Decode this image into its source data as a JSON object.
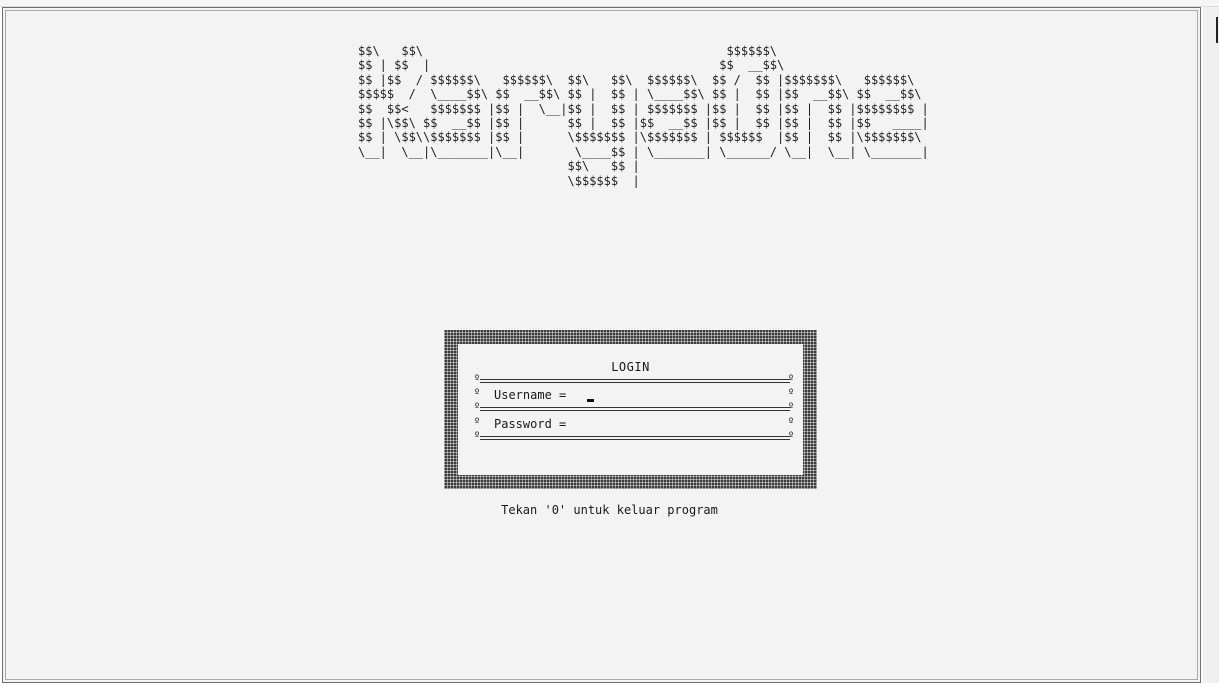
{
  "banner": {
    "ascii_art": "$$\\   $$\\                                          $$$$$$\\\n$$ | $$  |                                        $$  __$$\\\n$$ |$$  / $$$$$$\\   $$$$$$\\  $$\\   $$\\  $$$$$$\\  $$ /  $$ |$$$$$$$\\   $$$$$$\\\n$$$$$  /  \\____$$\\ $$  __$$\\ $$ |  $$ | \\____$$\\ $$ |  $$ |$$  __$$\\ $$  __$$\\\n$$  $$<   $$$$$$$ |$$ |  \\__|$$ |  $$ | $$$$$$$ |$$ |  $$ |$$ |  $$ |$$$$$$$$ |\n$$ |\\$$\\ $$  __$$ |$$ |      $$ |  $$ |$$  __$$ |$$ |  $$ |$$ |  $$ |$$   ____|\n$$ | \\$$\\\\$$$$$$$ |$$ |      \\$$$$$$$ |\\$$$$$$$ | $$$$$$  |$$ |  $$ |\\$$$$$$$\\\n\\__|  \\__|\\_______|\\__|       \\____$$ | \\_______| \\______/ \\__|  \\__| \\_______|\n                             $$\\   $$ |\n                             \\$$$$$$  |"
  },
  "login": {
    "title": "LOGIN",
    "username_label": "Username =",
    "username_value": "",
    "password_label": "Password =",
    "password_value": "",
    "row_marker": "º"
  },
  "footer": {
    "exit_hint": "Tekan '0' untuk keluar program"
  }
}
